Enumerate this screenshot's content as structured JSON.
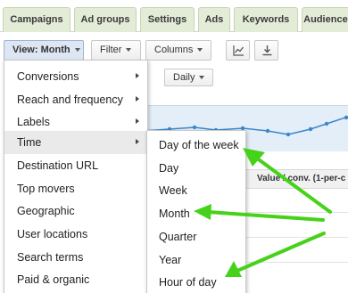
{
  "tabs": [
    "Campaigns",
    "Ad groups",
    "Settings",
    "Ads",
    "Keywords",
    "Audiences"
  ],
  "toolbar": {
    "view_label": "View: Month",
    "filter_label": "Filter",
    "columns_label": "Columns",
    "segment_label": "Daily"
  },
  "table": {
    "column_header": "Value / conv. (1-per-c"
  },
  "view_menu": {
    "items": [
      {
        "label": "Conversions",
        "submenu": true
      },
      {
        "label": "Reach and frequency",
        "submenu": true
      },
      {
        "label": "Labels",
        "submenu": true
      },
      {
        "label": "Time",
        "submenu": true
      },
      {
        "label": "Destination URL",
        "submenu": false
      },
      {
        "label": "Top movers",
        "submenu": false
      },
      {
        "label": "Geographic",
        "submenu": false
      },
      {
        "label": "User locations",
        "submenu": false
      },
      {
        "label": "Search terms",
        "submenu": false
      },
      {
        "label": "Paid & organic",
        "submenu": false
      }
    ]
  },
  "time_submenu": {
    "items": [
      "Day of the week",
      "Day",
      "Week",
      "Month",
      "Quarter",
      "Year",
      "Hour of day"
    ]
  },
  "colors": {
    "tab_bg": "#e3ecd7",
    "annotation_arrow": "#46d21a",
    "chart_line": "#3b87c9",
    "chart_fill": "#e3eef9"
  },
  "icons": [
    "line-chart-icon",
    "download-icon",
    "submenu-arrow-icon"
  ]
}
